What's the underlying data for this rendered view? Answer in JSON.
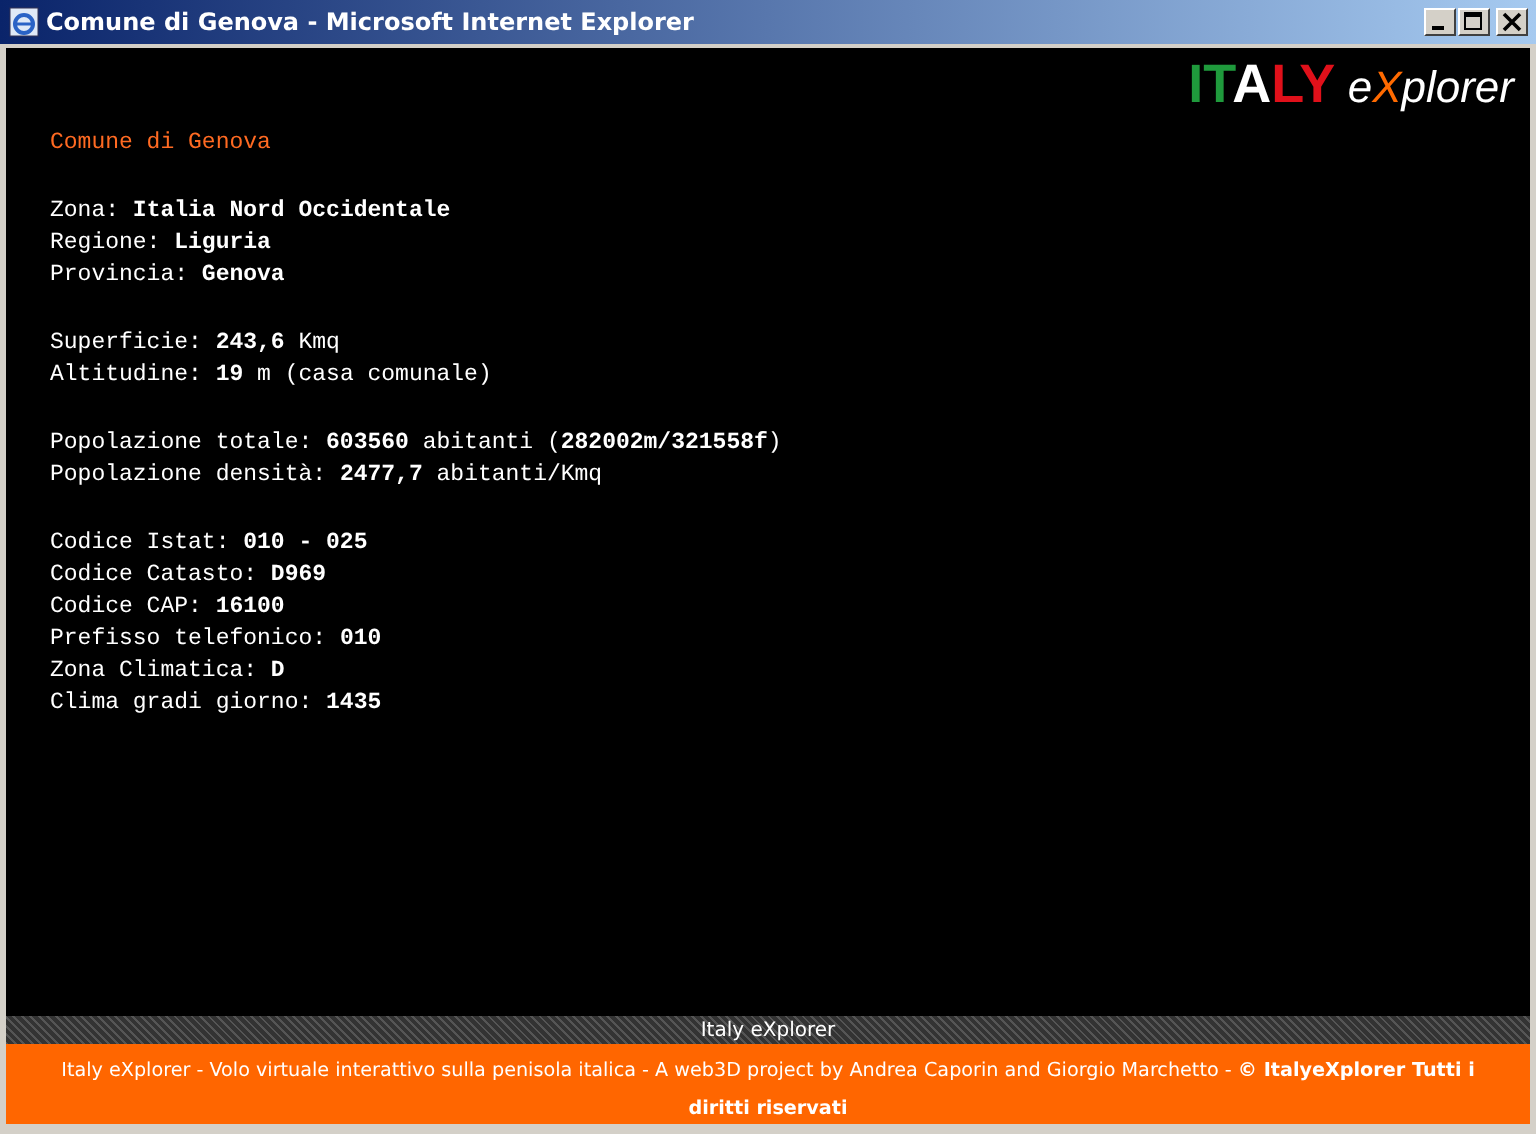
{
  "window": {
    "title": "Comune di Genova - Microsoft Internet Explorer"
  },
  "logo": [
    {
      "text": "IT",
      "color": "#1f9a3c"
    },
    {
      "text": "A",
      "color": "#ffffff"
    },
    {
      "text": "LY",
      "color": "#e0101a"
    },
    {
      "text": " e",
      "color": "#ffffff"
    },
    {
      "text": "X",
      "color": "#ff6a00"
    },
    {
      "text": "plorer",
      "color": "#ffffff"
    }
  ],
  "heading": "Comune di Genova",
  "groups": [
    [
      "Zona: **Italia Nord Occidentale**",
      "Regione: **Liguria**",
      "Provincia: **Genova**"
    ],
    [
      "Superficie: **243,6** Kmq",
      "Altitudine: **19** m (casa comunale)"
    ],
    [
      "Popolazione totale: **603560** abitanti (**282002m/321558f**)",
      "Popolazione densità: **2477,7** abitanti/Kmq"
    ],
    [
      "Codice Istat: **010 - 025**",
      "Codice Catasto: **D969**",
      "Codice CAP: **16100**",
      "Prefisso telefonico: **010**",
      "Zona Climatica: **D**",
      "Clima gradi giorno: **1435**"
    ]
  ],
  "band_title": "Italy eXplorer",
  "footer": "Italy eXplorer - Volo virtuale interattivo sulla penisola italica - A web3D project by Andrea Caporin and Giorgio Marchetto - **© ItalyeXplorer Tutti i diritti riservati**"
}
